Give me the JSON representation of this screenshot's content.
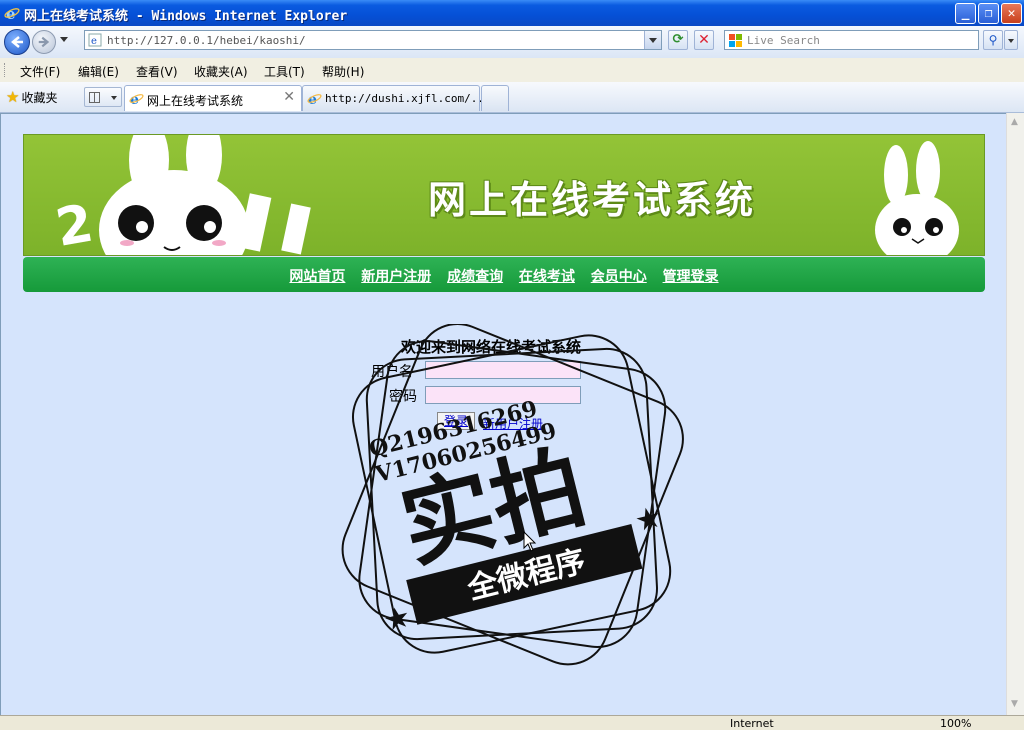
{
  "window": {
    "title": "网上在线考试系统 - Windows Internet Explorer",
    "minimize": "_",
    "maximize": "❐",
    "close": "✕"
  },
  "address_bar": {
    "url": "http://127.0.0.1/hebei/kaoshi/",
    "search_placeholder": "Live Search"
  },
  "menu": [
    "文件(F)",
    "编辑(E)",
    "查看(V)",
    "收藏夹(A)",
    "工具(T)",
    "帮助(H)"
  ],
  "tabs_bar": {
    "favorites_label": "收藏夹",
    "tabs": [
      {
        "label": "网上在线考试系统",
        "active": true
      },
      {
        "label": "http://dushi.xjfl.com/...",
        "active": false
      }
    ]
  },
  "page": {
    "banner_title": "网上在线考试系统",
    "nav_links": [
      "网站首页",
      "新用户注册",
      "成绩查询",
      "在线考试",
      "会员中心",
      "管理登录"
    ],
    "welcome": "欢迎来到网络在线考试系统",
    "username_label": "用户名",
    "password_label": "密码",
    "login_button": "登录",
    "register_link": "新用户注册"
  },
  "watermark": {
    "line1": "Q2196316269",
    "line2": "V17060256499",
    "big": "实拍",
    "ribbon": "全微程序"
  },
  "status": {
    "zone": "Internet",
    "zoom": "100%"
  },
  "colors": {
    "page_bg": "#d5e4fc",
    "banner_green": "#8cbf34",
    "nav_green": "#22a646",
    "input_bg": "#fbe3f8"
  }
}
